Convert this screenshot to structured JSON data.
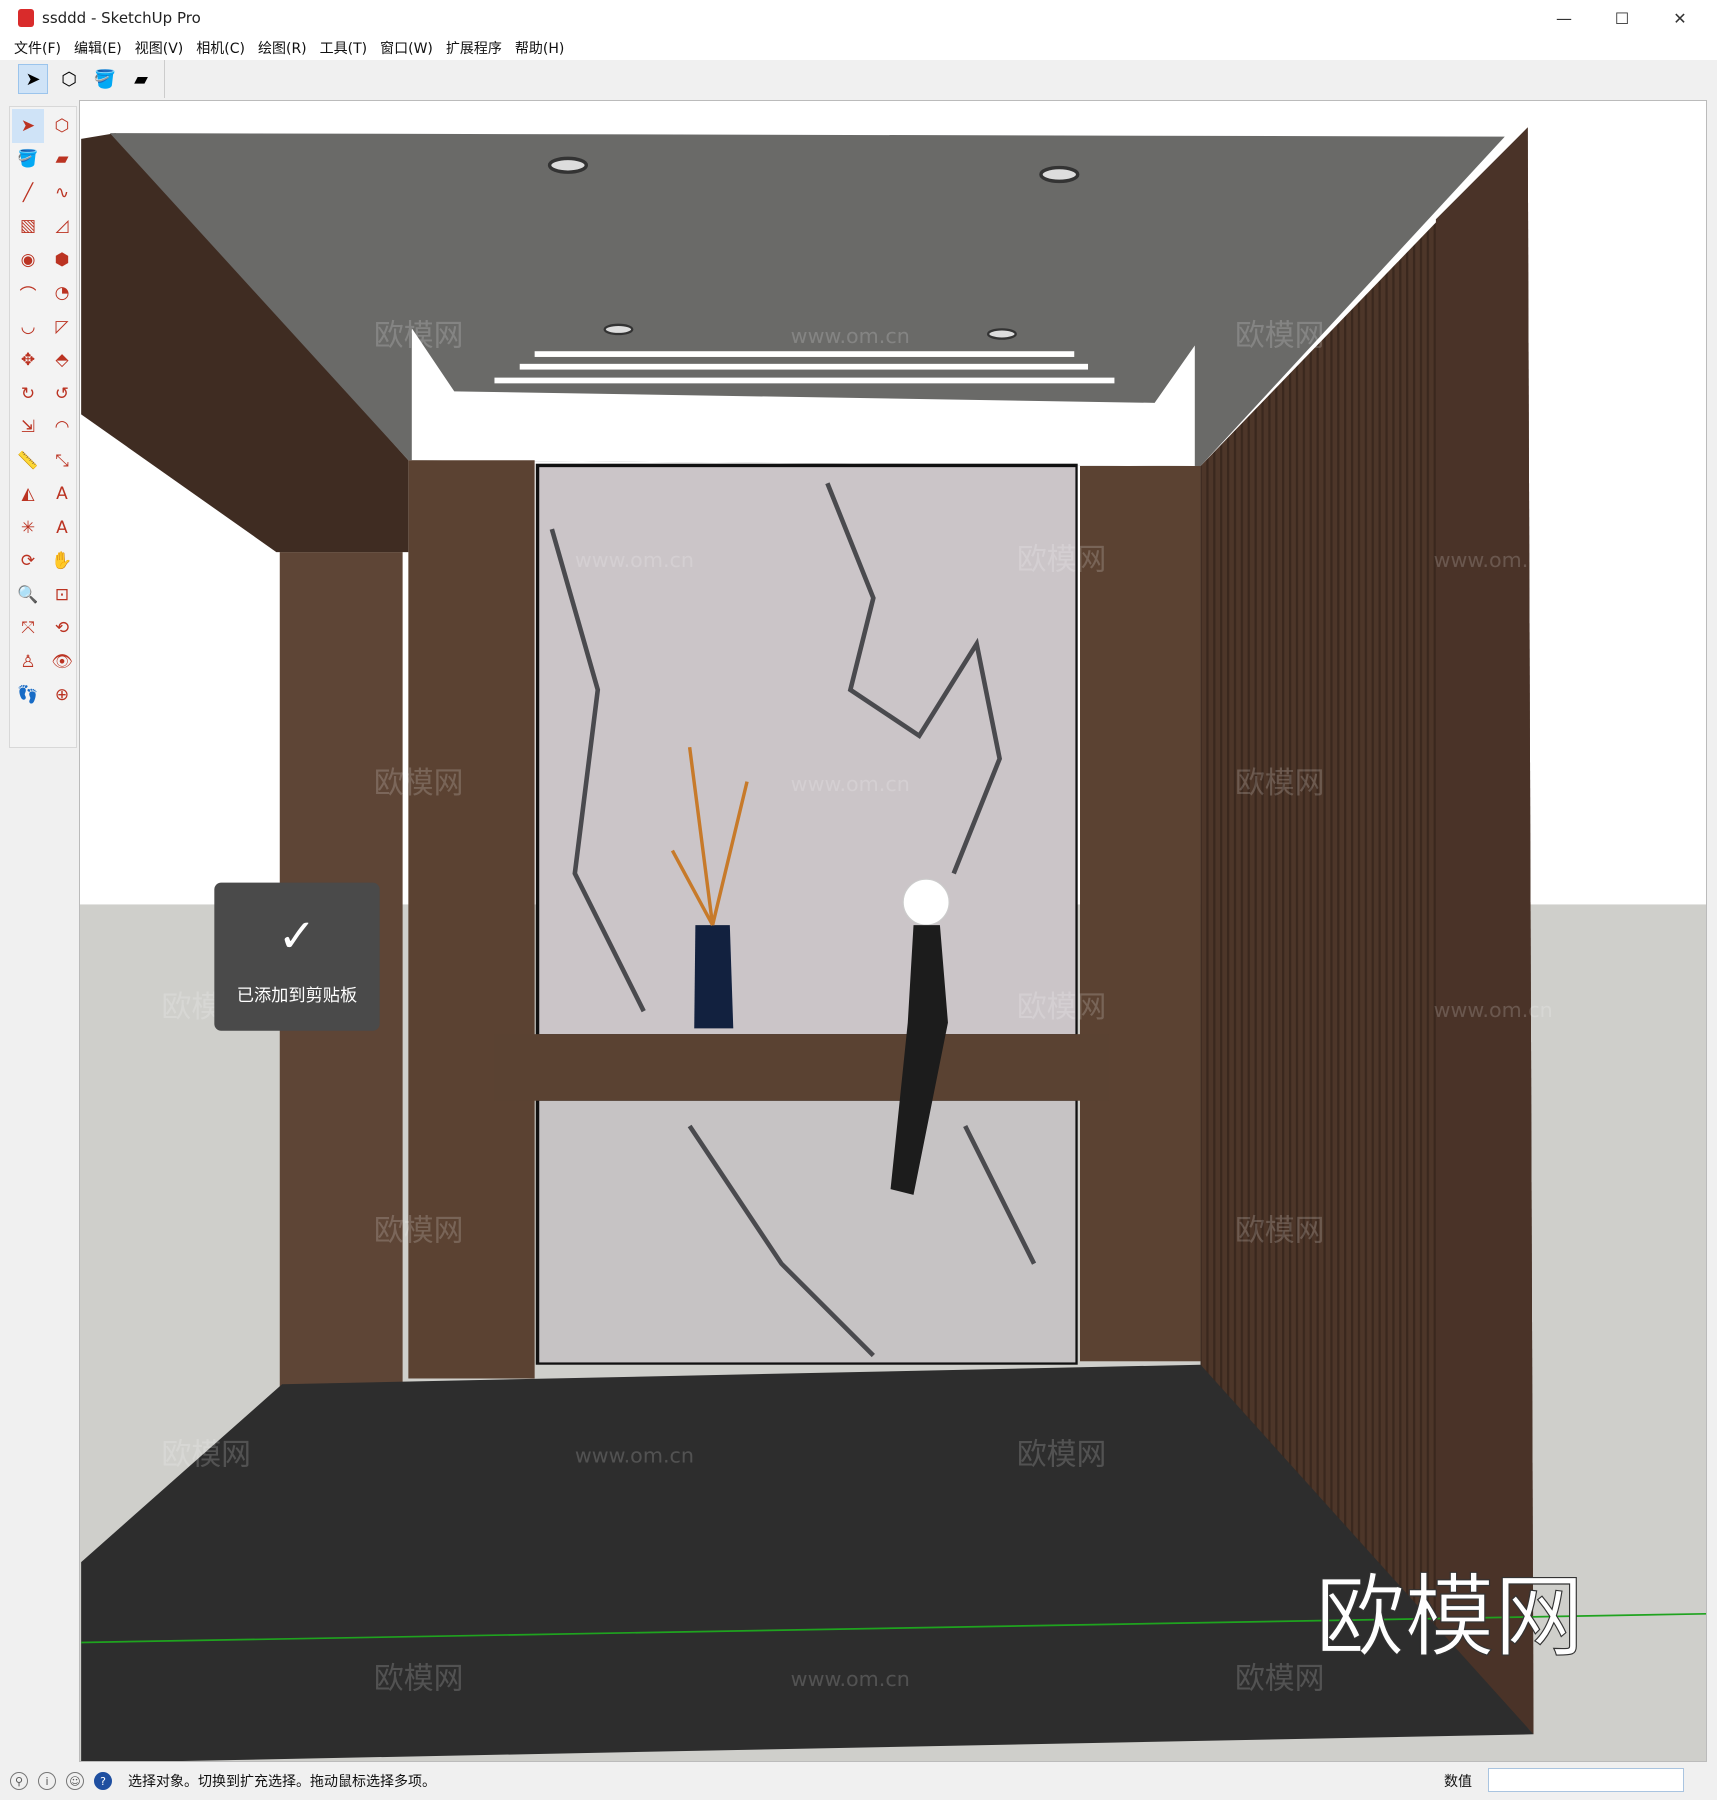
{
  "window": {
    "title": "ssddd - SketchUp Pro",
    "minimize": "—",
    "maximize": "☐",
    "close": "✕"
  },
  "menu": [
    "文件(F)",
    "编辑(E)",
    "视图(V)",
    "相机(C)",
    "绘图(R)",
    "工具(T)",
    "窗口(W)",
    "扩展程序",
    "帮助(H)"
  ],
  "toolbar": [
    {
      "name": "select-icon",
      "glyph": "➤"
    },
    {
      "name": "make-component-icon",
      "glyph": "⬡"
    },
    {
      "name": "paint-bucket-icon",
      "glyph": "🪣"
    },
    {
      "name": "eraser-icon",
      "glyph": "▰"
    }
  ],
  "left_tools": [
    {
      "name": "select-icon",
      "glyph": "➤"
    },
    {
      "name": "make-component-icon",
      "glyph": "⬡"
    },
    {
      "name": "paint-bucket-icon",
      "glyph": "🪣"
    },
    {
      "name": "eraser-icon",
      "glyph": "▰"
    },
    {
      "name": "line-icon",
      "glyph": "╱"
    },
    {
      "name": "freehand-icon",
      "glyph": "∿"
    },
    {
      "name": "rectangle-icon",
      "glyph": "▧"
    },
    {
      "name": "rotated-rectangle-icon",
      "glyph": "◿"
    },
    {
      "name": "circle-icon",
      "glyph": "◉"
    },
    {
      "name": "polygon-icon",
      "glyph": "⬢"
    },
    {
      "name": "arc-icon",
      "glyph": "⌒"
    },
    {
      "name": "pie-icon",
      "glyph": "◔"
    },
    {
      "name": "three-point-arc-icon",
      "glyph": "◡"
    },
    {
      "name": "two-point-arc-icon",
      "glyph": "◸"
    },
    {
      "name": "move-icon",
      "glyph": "✥"
    },
    {
      "name": "push-pull-icon",
      "glyph": "⬘"
    },
    {
      "name": "rotate-icon",
      "glyph": "↻"
    },
    {
      "name": "follow-me-icon",
      "glyph": "↺"
    },
    {
      "name": "scale-icon",
      "glyph": "⇲"
    },
    {
      "name": "offset-icon",
      "glyph": "◠"
    },
    {
      "name": "tape-measure-icon",
      "glyph": "📏"
    },
    {
      "name": "dimension-icon",
      "glyph": "⤡"
    },
    {
      "name": "protractor-icon",
      "glyph": "◭"
    },
    {
      "name": "text-icon",
      "glyph": "A"
    },
    {
      "name": "axes-icon",
      "glyph": "✳"
    },
    {
      "name": "3d-text-icon",
      "glyph": "A"
    },
    {
      "name": "orbit-icon",
      "glyph": "⟳"
    },
    {
      "name": "pan-icon",
      "glyph": "✋"
    },
    {
      "name": "zoom-icon",
      "glyph": "🔍"
    },
    {
      "name": "zoom-window-icon",
      "glyph": "⊡"
    },
    {
      "name": "zoom-extents-icon",
      "glyph": "⤧"
    },
    {
      "name": "previous-view-icon",
      "glyph": "⟲"
    },
    {
      "name": "position-camera-icon",
      "glyph": "♙"
    },
    {
      "name": "look-around-icon",
      "glyph": "👁"
    },
    {
      "name": "walk-icon",
      "glyph": "👣"
    },
    {
      "name": "section-plane-icon",
      "glyph": "⊕"
    }
  ],
  "toast": {
    "check": "✓",
    "text": "已添加到剪贴板"
  },
  "watermark": {
    "logo": "欧模网",
    "small": "欧模网",
    "url": "www.om.cn"
  },
  "status": {
    "text": "选择对象。切换到扩充选择。拖动鼠标选择多项。",
    "vcb_label": "数值",
    "vcb_value": ""
  },
  "colors": {
    "wood": "#5b4232",
    "marble": "#cbc5c8",
    "floor": "#2d2d2d",
    "ceiling": "#6a6a68",
    "axis_green": "#1fa31f"
  }
}
